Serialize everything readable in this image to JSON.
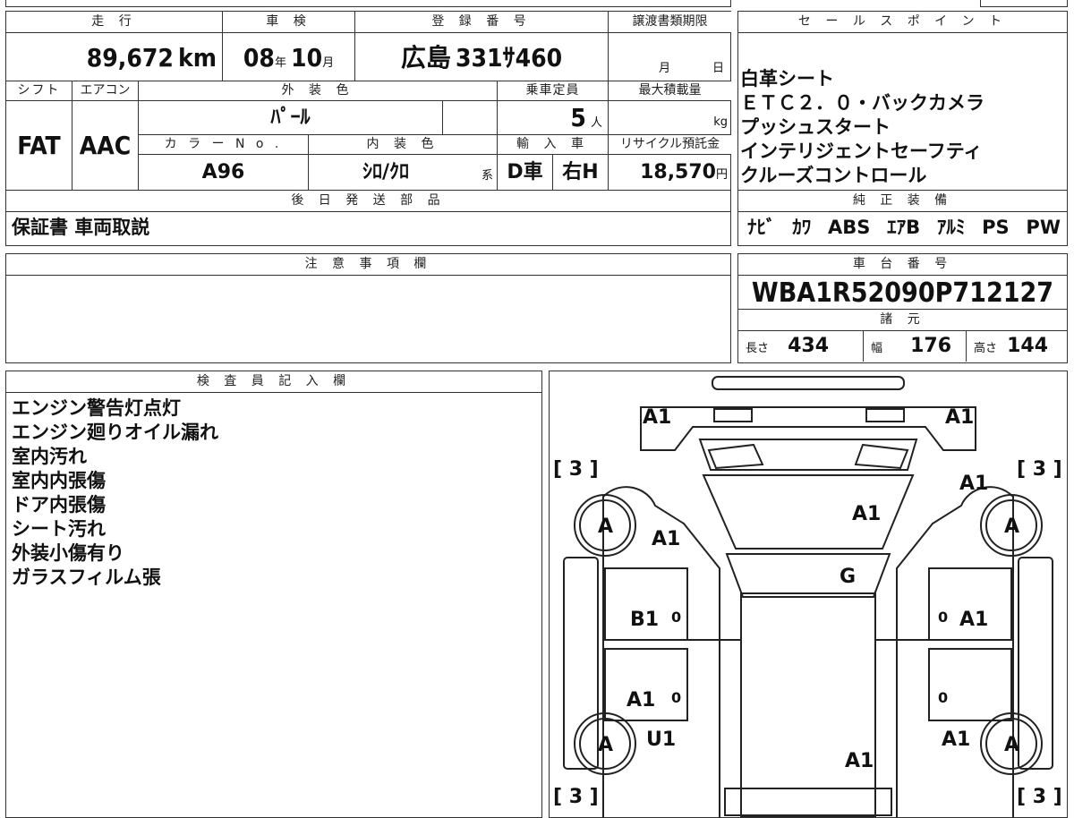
{
  "top_table": {
    "headers": {
      "mileage": "走 行",
      "inspection": "車 検",
      "registration": "登 録 番 号",
      "transfer_deadline": "譲渡書類期限",
      "shift": "シフト",
      "aircon": "エアコン",
      "exterior_color": "外 装 色",
      "capacity": "乗車定員",
      "max_load": "最大積載量",
      "color_no": "カ ラ ー N o .",
      "interior_color": "内 装 色",
      "import": "輸 入 車",
      "recycle": "リサイクル預託金"
    },
    "mileage_value": "89,672",
    "mileage_unit": "km",
    "inspection_year": "08",
    "inspection_year_unit": "年",
    "inspection_month": "10",
    "inspection_month_unit": "月",
    "registration_area": "広島",
    "registration_number": "331",
    "registration_kana": "ｻ",
    "registration_serial": "460",
    "deadline_month_unit": "月",
    "deadline_day_unit": "日",
    "shift_value": "FAT",
    "aircon_value": "AAC",
    "exterior_color_value": "ﾊﾟｰﾙ",
    "capacity_value": "5",
    "capacity_unit": "人",
    "max_load_unit": "kg",
    "color_no_value": "A96",
    "interior_color_value": "ｼﾛ/ｸﾛ",
    "interior_color_suffix": "系",
    "import_type": "D車",
    "steering": "右H",
    "recycle_value": "18,570",
    "recycle_unit": "円"
  },
  "later_parts": {
    "header": "後 日 発 送 部 品",
    "value": "保証書 車両取説"
  },
  "notes": {
    "header": "注 意 事 項 欄"
  },
  "sales_points": {
    "header": "セ ー ル ス ポ イ ン ト",
    "items": [
      "白革シート",
      "ＥＴＣ２．０・バックカメラ",
      "プッシュスタート",
      "インテリジェントセーフティ",
      "クルーズコントロール"
    ]
  },
  "equipment": {
    "header": "純 正 装 備",
    "items": [
      "ﾅﾋﾞ",
      "ｶﾜ",
      "ABS",
      "ｴｱB",
      "ｱﾙﾐ",
      "PS",
      "PW"
    ]
  },
  "chassis": {
    "header": "車 台 番 号",
    "value": "WBA1R52090P712127"
  },
  "specs": {
    "header": "諸 元",
    "length_label": "長さ",
    "length_value": "434",
    "width_label": "幅",
    "width_value": "176",
    "height_label": "高さ",
    "height_value": "144"
  },
  "inspector": {
    "header": "検 査 員 記 入 欄",
    "items": [
      "エンジン警告灯点灯",
      "エンジン廻りオイル漏れ",
      "室内汚れ",
      "室内内張傷",
      "ドア内張傷",
      "シート汚れ",
      "外装小傷有り",
      "ガラスフィルム張"
    ]
  },
  "diagram": {
    "marks": {
      "front_left": "A1",
      "front_right": "A1",
      "hood": "A1",
      "front_fender_left": "A1",
      "front_fender_right": "A1",
      "windshield": "G",
      "front_door_left": "B1",
      "front_door_right": "A1",
      "rear_door_left": "A1",
      "rear_fender_left": "U1",
      "rear_fender_right": "A1",
      "roof_rear": "A1",
      "wheel_fl": "A",
      "wheel_fr": "A",
      "wheel_rl": "A",
      "wheel_rr": "A",
      "tire_fl": "[ 3 ]",
      "tire_fr": "[ 3 ]",
      "tire_rl": "[ 3 ]",
      "tire_rr": "[ 3 ]",
      "zero": "0"
    }
  }
}
